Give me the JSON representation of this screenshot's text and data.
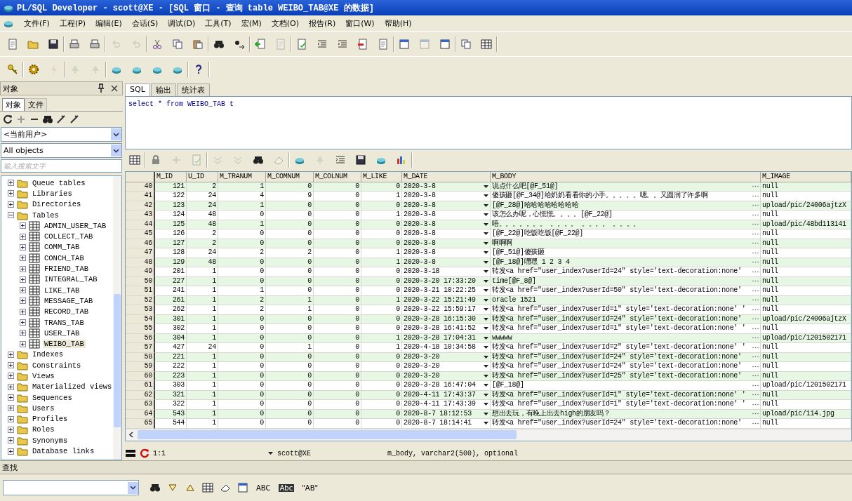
{
  "window": {
    "title": "PL/SQL Developer - scott@XE - [SQL 窗口 - 查询 table WEIBO_TAB@XE 的数据]"
  },
  "menu": [
    "文件(F)",
    "工程(P)",
    "编辑(E)",
    "会话(S)",
    "调试(D)",
    "工具(T)",
    "宏(M)",
    "文档(O)",
    "报告(R)",
    "窗口(W)",
    "帮助(H)"
  ],
  "object_panel": {
    "title": "对象",
    "tabs": [
      {
        "label": "对象",
        "selected": true
      },
      {
        "label": "文件",
        "selected": false
      }
    ],
    "owner_select": "<当前用户>",
    "type_select": "All objects",
    "search": {
      "placeholder": "输入搜索文字"
    },
    "tree": [
      {
        "kind": "folder",
        "label": "Queue tables",
        "expanded": false,
        "selected": false
      },
      {
        "kind": "folder",
        "label": "Libraries",
        "expanded": false,
        "selected": false
      },
      {
        "kind": "folder",
        "label": "Directories",
        "expanded": false,
        "selected": false
      },
      {
        "kind": "folder",
        "label": "Tables",
        "expanded": true,
        "selected": false,
        "children": [
          {
            "kind": "table",
            "label": "ADMIN_USER_TAB",
            "expanded": false,
            "selected": false
          },
          {
            "kind": "table",
            "label": "COLLECT_TAB",
            "expanded": false,
            "selected": false
          },
          {
            "kind": "table",
            "label": "COMM_TAB",
            "expanded": false,
            "selected": false
          },
          {
            "kind": "table",
            "label": "CONCH_TAB",
            "expanded": false,
            "selected": false
          },
          {
            "kind": "table",
            "label": "FRIEND_TAB",
            "expanded": false,
            "selected": false
          },
          {
            "kind": "table",
            "label": "INTEGRAL_TAB",
            "expanded": false,
            "selected": false
          },
          {
            "kind": "table",
            "label": "LIKE_TAB",
            "expanded": false,
            "selected": false
          },
          {
            "kind": "table",
            "label": "MESSAGE_TAB",
            "expanded": false,
            "selected": false
          },
          {
            "kind": "table",
            "label": "RECORD_TAB",
            "expanded": false,
            "selected": false
          },
          {
            "kind": "table",
            "label": "TRANS_TAB",
            "expanded": false,
            "selected": false
          },
          {
            "kind": "table",
            "label": "USER_TAB",
            "expanded": false,
            "selected": false
          },
          {
            "kind": "table",
            "label": "WEIBO_TAB",
            "expanded": false,
            "selected": true
          }
        ]
      },
      {
        "kind": "folder",
        "label": "Indexes",
        "expanded": false,
        "selected": false
      },
      {
        "kind": "folder",
        "label": "Constraints",
        "expanded": false,
        "selected": false
      },
      {
        "kind": "folder",
        "label": "Views",
        "expanded": false,
        "selected": false
      },
      {
        "kind": "folder",
        "label": "Materialized views",
        "expanded": false,
        "selected": false
      },
      {
        "kind": "folder",
        "label": "Sequences",
        "expanded": false,
        "selected": false
      },
      {
        "kind": "folder",
        "label": "Users",
        "expanded": false,
        "selected": false
      },
      {
        "kind": "folder",
        "label": "Profiles",
        "expanded": false,
        "selected": false
      },
      {
        "kind": "folder",
        "label": "Roles",
        "expanded": false,
        "selected": false
      },
      {
        "kind": "folder",
        "label": "Synonyms",
        "expanded": false,
        "selected": false
      },
      {
        "kind": "folder",
        "label": "Database links",
        "expanded": false,
        "selected": false
      }
    ]
  },
  "editor_tabs": [
    {
      "label": "SQL",
      "selected": true
    },
    {
      "label": "输出",
      "selected": false
    },
    {
      "label": "统计表",
      "selected": false
    }
  ],
  "sql": "select * from WEIBO_TAB t",
  "table": {
    "columns": [
      "M_ID",
      "U_ID",
      "M_TRANUM",
      "M_COMNUM",
      "M_COLNUM",
      "M_LIKE",
      "M_DATE",
      "M_BODY",
      "M_IMAGE"
    ],
    "rows": [
      {
        "row_no": "40",
        "m_id": "121",
        "u_id": "2",
        "m_tranum": "1",
        "m_comnum": "0",
        "m_colnum": "0",
        "m_like": "0",
        "m_date": "2020-3-8",
        "m_body": "说点什么吧[@F_51@]",
        "m_image": "null"
      },
      {
        "row_no": "41",
        "m_id": "122",
        "u_id": "24",
        "m_tranum": "4",
        "m_comnum": "9",
        "m_colnum": "0",
        "m_like": "1",
        "m_date": "2020-3-8",
        "m_body": "傻孩砸[@F_34@]给奶奶看看你的小手。。。。。嗯。。又圆润了许多啊",
        "m_image": "null"
      },
      {
        "row_no": "42",
        "m_id": "123",
        "u_id": "24",
        "m_tranum": "1",
        "m_comnum": "0",
        "m_colnum": "0",
        "m_like": "0",
        "m_date": "2020-3-8",
        "m_body": "[@F_28@]哈哈哈哈哈哈哈哈",
        "m_image": "upload/pic/24006ajtzX"
      },
      {
        "row_no": "43",
        "m_id": "124",
        "u_id": "48",
        "m_tranum": "0",
        "m_comnum": "0",
        "m_colnum": "0",
        "m_like": "1",
        "m_date": "2020-3-8",
        "m_body": "该怎么办呢，心慌慌。。。。[@F_22@]",
        "m_image": "null"
      },
      {
        "row_no": "44",
        "m_id": "125",
        "u_id": "48",
        "m_tranum": "1",
        "m_comnum": "0",
        "m_colnum": "0",
        "m_like": "0",
        "m_date": "2020-3-8",
        "m_body": "唔。。。。。。。 。。。。 。。。。 。。。。",
        "m_image": "upload/pic/48bd113141"
      },
      {
        "row_no": "45",
        "m_id": "126",
        "u_id": "2",
        "m_tranum": "0",
        "m_comnum": "0",
        "m_colnum": "0",
        "m_like": "0",
        "m_date": "2020-3-8",
        "m_body": "[@F_22@]吃饭吃饭[@F_22@]",
        "m_image": "null"
      },
      {
        "row_no": "46",
        "m_id": "127",
        "u_id": "2",
        "m_tranum": "0",
        "m_comnum": "0",
        "m_colnum": "0",
        "m_like": "0",
        "m_date": "2020-3-8",
        "m_body": "啊啊啊",
        "m_image": "null"
      },
      {
        "row_no": "47",
        "m_id": "128",
        "u_id": "24",
        "m_tranum": "2",
        "m_comnum": "2",
        "m_colnum": "0",
        "m_like": "1",
        "m_date": "2020-3-8",
        "m_body": "[@F_51@]傻孩砸",
        "m_image": "null"
      },
      {
        "row_no": "48",
        "m_id": "129",
        "u_id": "48",
        "m_tranum": "0",
        "m_comnum": "0",
        "m_colnum": "0",
        "m_like": "1",
        "m_date": "2020-3-8",
        "m_body": "[@F_18@]嘿嘿 1 2 3 4",
        "m_image": "null"
      },
      {
        "row_no": "49",
        "m_id": "201",
        "u_id": "1",
        "m_tranum": "0",
        "m_comnum": "0",
        "m_colnum": "0",
        "m_like": "0",
        "m_date": "2020-3-18",
        "m_body": "转发<a href=\"user_index?userId=24\" style='text-decoration:none'",
        "m_image": "null"
      },
      {
        "row_no": "50",
        "m_id": "227",
        "u_id": "1",
        "m_tranum": "0",
        "m_comnum": "0",
        "m_colnum": "0",
        "m_like": "0",
        "m_date": "2020-3-20 17:33:20",
        "m_body": "time[@F_8@]",
        "m_image": "null"
      },
      {
        "row_no": "51",
        "m_id": "241",
        "u_id": "1",
        "m_tranum": "1",
        "m_comnum": "0",
        "m_colnum": "0",
        "m_like": "0",
        "m_date": "2020-3-21 10:22:25",
        "m_body": "转发<a href=\"user_index?userId=50\" style='text-decoration:none'",
        "m_image": "null"
      },
      {
        "row_no": "52",
        "m_id": "261",
        "u_id": "1",
        "m_tranum": "2",
        "m_comnum": "1",
        "m_colnum": "0",
        "m_like": "1",
        "m_date": "2020-3-22 15:21:49",
        "m_body": "oracle 1521",
        "m_image": "null"
      },
      {
        "row_no": "53",
        "m_id": "262",
        "u_id": "1",
        "m_tranum": "2",
        "m_comnum": "1",
        "m_colnum": "0",
        "m_like": "0",
        "m_date": "2020-3-22 15:59:17",
        "m_body": "转发<a href=\"user_index?userId=1\" style='text-decoration:none' '",
        "m_image": "null"
      },
      {
        "row_no": "54",
        "m_id": "301",
        "u_id": "1",
        "m_tranum": "0",
        "m_comnum": "0",
        "m_colnum": "0",
        "m_like": "0",
        "m_date": "2020-3-28 16:15:30",
        "m_body": "转发<a href=\"user_index?userId=24\" style='text-decoration:none'",
        "m_image": "upload/pic/24006ajtzX"
      },
      {
        "row_no": "55",
        "m_id": "302",
        "u_id": "1",
        "m_tranum": "0",
        "m_comnum": "0",
        "m_colnum": "0",
        "m_like": "0",
        "m_date": "2020-3-28 16:41:52",
        "m_body": "转发<a href=\"user_index?userId=1\" style='text-decoration:none' '",
        "m_image": "null"
      },
      {
        "row_no": "56",
        "m_id": "304",
        "u_id": "1",
        "m_tranum": "0",
        "m_comnum": "0",
        "m_colnum": "0",
        "m_like": "1",
        "m_date": "2020-3-28 17:04:31",
        "m_body": "wwwww",
        "m_image": "upload/pic/1201502171"
      },
      {
        "row_no": "57",
        "m_id": "427",
        "u_id": "24",
        "m_tranum": "0",
        "m_comnum": "1",
        "m_colnum": "0",
        "m_like": "1",
        "m_date": "2020-4-18 10:34:58",
        "m_body": "转发<a href=\"user_index?userId=2\" style='text-decoration:none' '",
        "m_image": "null"
      },
      {
        "row_no": "58",
        "m_id": "221",
        "u_id": "1",
        "m_tranum": "0",
        "m_comnum": "0",
        "m_colnum": "0",
        "m_like": "0",
        "m_date": "2020-3-20",
        "m_body": "转发<a href=\"user_index?userId=24\" style='text-decoration:none'",
        "m_image": "null"
      },
      {
        "row_no": "59",
        "m_id": "222",
        "u_id": "1",
        "m_tranum": "0",
        "m_comnum": "0",
        "m_colnum": "0",
        "m_like": "0",
        "m_date": "2020-3-20",
        "m_body": "转发<a href=\"user_index?userId=24\" style='text-decoration:none'",
        "m_image": "null"
      },
      {
        "row_no": "60",
        "m_id": "223",
        "u_id": "1",
        "m_tranum": "0",
        "m_comnum": "0",
        "m_colnum": "0",
        "m_like": "0",
        "m_date": "2020-3-20",
        "m_body": "转发<a href=\"user_index?userId=25\" style='text-decoration:none'",
        "m_image": "null"
      },
      {
        "row_no": "61",
        "m_id": "303",
        "u_id": "1",
        "m_tranum": "0",
        "m_comnum": "0",
        "m_colnum": "0",
        "m_like": "0",
        "m_date": "2020-3-28 16:47:04",
        "m_body": "[@F_18@]",
        "m_image": "upload/pic/1201502171"
      },
      {
        "row_no": "62",
        "m_id": "321",
        "u_id": "1",
        "m_tranum": "0",
        "m_comnum": "0",
        "m_colnum": "0",
        "m_like": "0",
        "m_date": "2020-4-11 17:43:37",
        "m_body": "转发<a href=\"user_index?userId=1\" style='text-decoration:none' '",
        "m_image": "null"
      },
      {
        "row_no": "63",
        "m_id": "322",
        "u_id": "1",
        "m_tranum": "0",
        "m_comnum": "0",
        "m_colnum": "0",
        "m_like": "0",
        "m_date": "2020-4-11 17:43:39",
        "m_body": "转发<a href=\"user_index?userId=1\" style='text-decoration:none' '",
        "m_image": "null"
      },
      {
        "row_no": "64",
        "m_id": "543",
        "u_id": "1",
        "m_tranum": "0",
        "m_comnum": "0",
        "m_colnum": "0",
        "m_like": "0",
        "m_date": "2020-8-7 18:12:53",
        "m_body": "想出去玩，有晚上出去high的朋友吗？",
        "m_image": "upload/pic/114.jpg"
      },
      {
        "row_no": "65",
        "m_id": "544",
        "u_id": "1",
        "m_tranum": "0",
        "m_comnum": "0",
        "m_colnum": "0",
        "m_like": "0",
        "m_date": "2020-8-7 18:14:41",
        "m_body": "转发<a href=\"user_index?userId=24\" style='text-decoration:none'",
        "m_image": "null"
      }
    ]
  },
  "status_bar": {
    "position": "1:1",
    "connection": "scott@XE",
    "field_info": "m_body, varchar2(500), optional"
  },
  "find_panel": {
    "title": "查找",
    "text_buttons": [
      "ABC",
      "Abc",
      "\"AB\""
    ]
  }
}
